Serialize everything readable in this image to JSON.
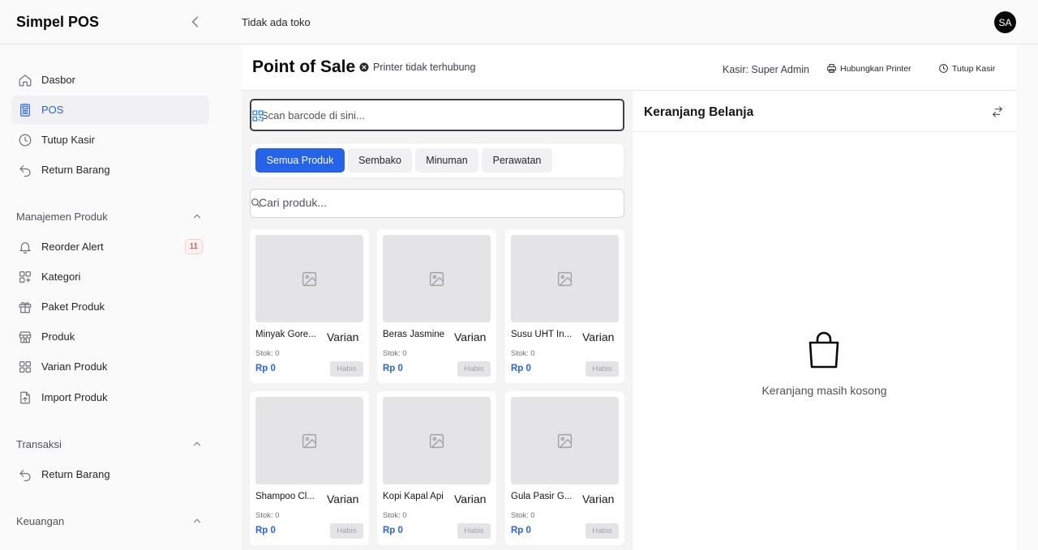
{
  "app": {
    "brand": "Simpel POS",
    "store": "Tidak ada toko",
    "avatar_initials": "SA"
  },
  "sidebar": {
    "main_items": [
      {
        "label": "Dasbor",
        "icon": "home-icon"
      },
      {
        "label": "POS",
        "icon": "calculator-icon",
        "active": true
      },
      {
        "label": "Tutup Kasir",
        "icon": "clock-icon"
      },
      {
        "label": "Return Barang",
        "icon": "undo-icon"
      }
    ],
    "sections": [
      {
        "title": "Manajemen Produk",
        "items": [
          {
            "label": "Reorder Alert",
            "icon": "bell-icon",
            "badge": "11"
          },
          {
            "label": "Kategori",
            "icon": "grid-plus-icon"
          },
          {
            "label": "Paket Produk",
            "icon": "gift-icon"
          },
          {
            "label": "Produk",
            "icon": "store-icon"
          },
          {
            "label": "Varian Produk",
            "icon": "grid-icon"
          },
          {
            "label": "Import Produk",
            "icon": "file-upload-icon"
          }
        ]
      },
      {
        "title": "Transaksi",
        "items": [
          {
            "label": "Return Barang",
            "icon": "undo-icon"
          }
        ]
      },
      {
        "title": "Keuangan",
        "items": []
      }
    ]
  },
  "pos": {
    "title": "Point of Sale",
    "printer_status": "Printer tidak terhubung",
    "cashier": "Kasir: Super Admin",
    "connect_printer_label": "Hubungkan Printer",
    "close_register_label": "Tutup Kasir",
    "scan_placeholder": "Scan barcode di sini...",
    "search_placeholder": "Cari produk...",
    "categories": [
      "Semua Produk",
      "Sembako",
      "Minuman",
      "Perawatan"
    ],
    "active_category": "Semua Produk",
    "products": [
      {
        "name": "Minyak Gore...",
        "variant": "Varian",
        "stock": "Stok: 0",
        "price": "Rp 0",
        "status": "Habis"
      },
      {
        "name": "Beras Jasmine",
        "variant": "Varian",
        "stock": "Stok: 0",
        "price": "Rp 0",
        "status": "Habis"
      },
      {
        "name": "Susu UHT In...",
        "variant": "Varian",
        "stock": "Stok: 0",
        "price": "Rp 0",
        "status": "Habis"
      },
      {
        "name": "Shampoo Cl...",
        "variant": "Varian",
        "stock": "Stok: 0",
        "price": "Rp 0",
        "status": "Habis"
      },
      {
        "name": "Kopi Kapal Api",
        "variant": "Varian",
        "stock": "Stok: 0",
        "price": "Rp 0",
        "status": "Habis"
      },
      {
        "name": "Gula Pasir G...",
        "variant": "Varian",
        "stock": "Stok: 0",
        "price": "Rp 0",
        "status": "Habis"
      }
    ]
  },
  "cart": {
    "title": "Keranjang Belanja",
    "empty_text": "Keranjang masih kosong"
  },
  "colors": {
    "accent": "#2563eb",
    "badge_red": "#dc2626",
    "dark": "#09090b"
  }
}
